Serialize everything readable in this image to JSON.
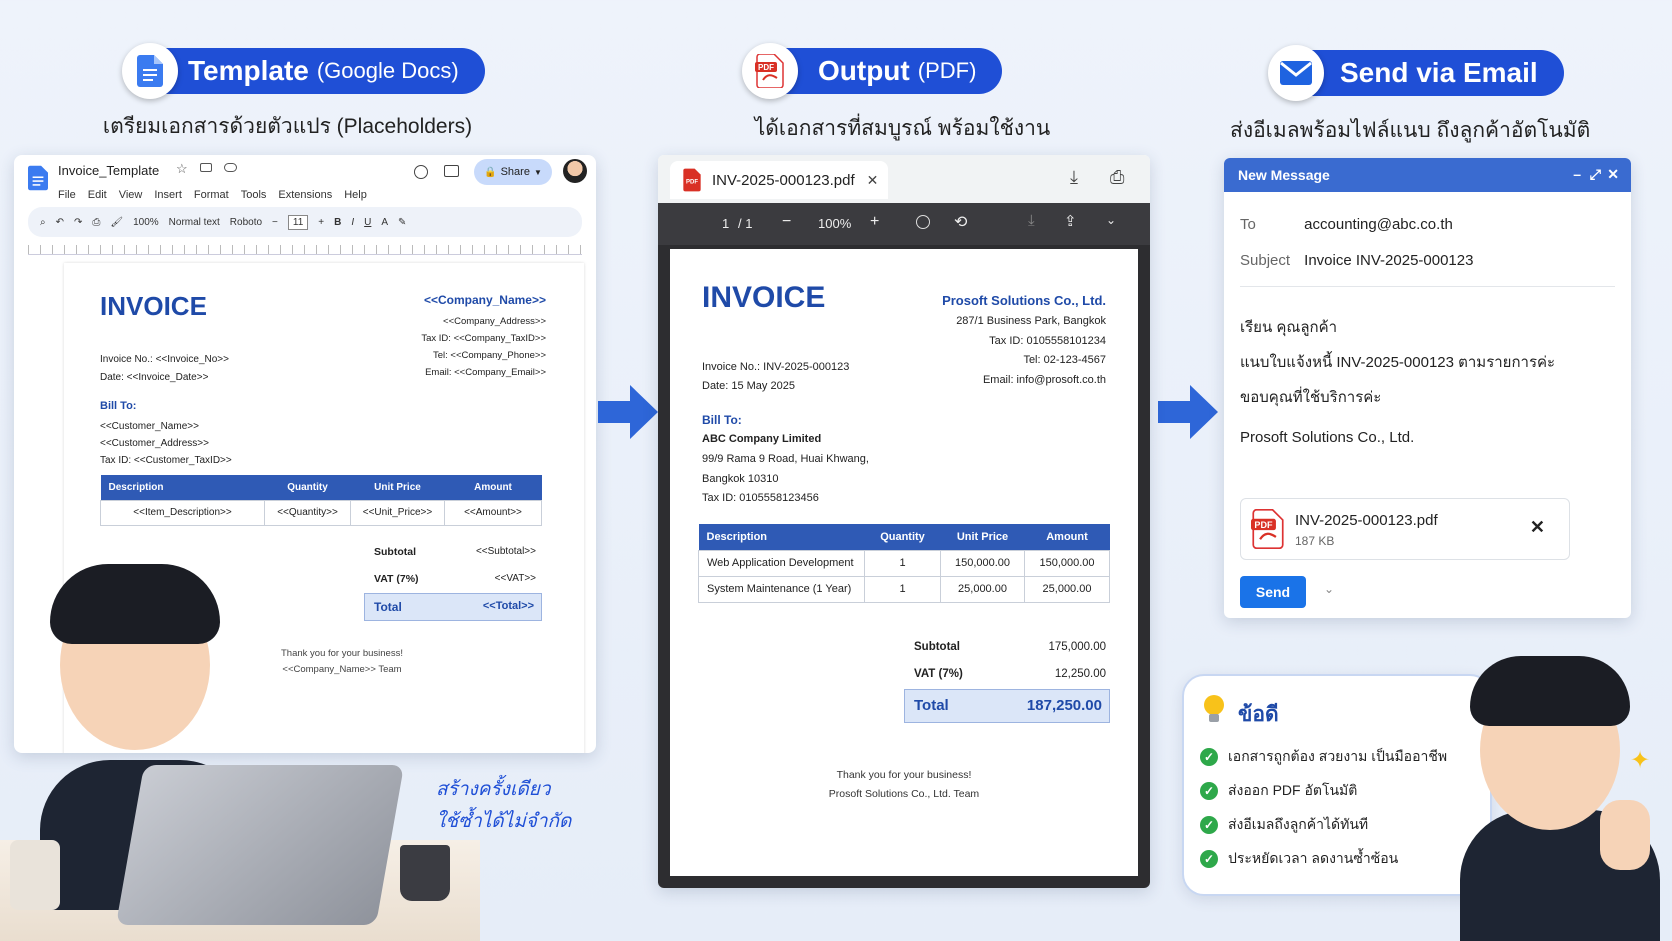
{
  "header": {
    "template_title": "Template",
    "template_sub": "(Google Docs)",
    "template_caption": "เตรียมเอกสารด้วยตัวแปร (Placeholders)",
    "output_title": "Output",
    "output_sub": "(PDF)",
    "output_caption": "ได้เอกสารที่สมบูรณ์ พร้อมใช้งาน",
    "email_title": "Send via Email",
    "email_caption": "ส่งอีเมลพร้อมไฟล์แนบ ถึงลูกค้าอัตโนมัติ"
  },
  "docs": {
    "filename": "Invoice_Template",
    "menu": [
      "File",
      "Edit",
      "View",
      "Insert",
      "Format",
      "Tools",
      "Extensions",
      "Help"
    ],
    "share_label": "Share",
    "zoom": "100%",
    "style": "Normal text",
    "font": "Roboto",
    "font_size": "11",
    "bold": "B",
    "italic": "I",
    "underline": "U",
    "color": "A",
    "invoice_title": "INVOICE",
    "company_name": "<<Company_Name>>",
    "company_lines": [
      "<<Company_Address>>",
      "Tax ID: <<Company_TaxID>>",
      "Tel: <<Company_Phone>>",
      "Email: <<Company_Email>>"
    ],
    "invoice_no": "Invoice No.: <<Invoice_No>>",
    "date": "Date: <<Invoice_Date>>",
    "bill_to": "Bill To:",
    "customer_lines": [
      "<<Customer_Name>>",
      "<<Customer_Address>>",
      "Tax ID: <<Customer_TaxID>>"
    ],
    "table_headers": [
      "Description",
      "Quantity",
      "Unit Price",
      "Amount"
    ],
    "table_row": [
      "<<Item_Description>>",
      "<<Quantity>>",
      "<<Unit_Price>>",
      "<<Amount>>"
    ],
    "subtotal_label": "Subtotal",
    "subtotal_value": "<<Subtotal>>",
    "vat_label": "VAT (7%)",
    "vat_value": "<<VAT>>",
    "total_label": "Total",
    "total_value": "<<Total>>",
    "thanks": "Thank you for your business!",
    "team": "<<Company_Name>> Team"
  },
  "pdf": {
    "tab_title": "INV-2025-000123.pdf",
    "page": "1",
    "page_total": "/ 1",
    "zoom": "100%",
    "invoice_title": "INVOICE",
    "company_name": "Prosoft Solutions Co., Ltd.",
    "company_lines": [
      "287/1 Business Park, Bangkok",
      "Tax ID: 0105558101234",
      "Tel: 02-123-4567",
      "Email: info@prosoft.co.th"
    ],
    "invoice_no": "Invoice No.: INV-2025-000123",
    "date": "Date: 15 May 2025",
    "bill_to": "Bill To:",
    "customer_name": "ABC Company Limited",
    "customer_lines": [
      "99/9 Rama 9 Road, Huai Khwang,",
      "Bangkok 10310",
      "Tax ID: 0105558123456"
    ],
    "table_headers": [
      "Description",
      "Quantity",
      "Unit Price",
      "Amount"
    ],
    "rows": [
      [
        "Web Application Development",
        "1",
        "150,000.00",
        "150,000.00"
      ],
      [
        "System Maintenance (1 Year)",
        "1",
        "25,000.00",
        "25,000.00"
      ]
    ],
    "subtotal_label": "Subtotal",
    "subtotal_value": "175,000.00",
    "vat_label": "VAT (7%)",
    "vat_value": "12,250.00",
    "total_label": "Total",
    "total_value": "187,250.00",
    "thanks": "Thank you for your business!",
    "team": "Prosoft Solutions Co., Ltd. Team"
  },
  "email": {
    "window_title": "New Message",
    "to_label": "To",
    "to_value": "accounting@abc.co.th",
    "subject_label": "Subject",
    "subject_value": "Invoice INV-2025-000123",
    "body": [
      "เรียน คุณลูกค้า",
      "แนบใบแจ้งหนี้ INV-2025-000123 ตามรายการค่ะ",
      "ขอบคุณที่ใช้บริการค่ะ",
      "Prosoft Solutions Co., Ltd."
    ],
    "attachment_name": "INV-2025-000123.pdf",
    "attachment_size": "187 KB",
    "send_label": "Send"
  },
  "benefits": {
    "title": "ข้อดี",
    "items": [
      "เอกสารถูกต้อง สวยงาม เป็นมืออาชีพ",
      "ส่งออก PDF อัตโนมัติ",
      "ส่งอีเมลถึงลูกค้าได้ทันที",
      "ประหยัดเวลา ลดงานซ้ำซ้อน"
    ]
  },
  "handwritten": [
    "สร้างครั้งเดียว",
    "ใช้ซ้ำได้ไม่จำกัด"
  ],
  "icons": {
    "docs": "google-docs-icon",
    "pdf": "pdf-icon",
    "mail": "mail-icon",
    "bulb": "lightbulb-icon"
  },
  "colors": {
    "accent": "#1f4fd6",
    "invoice_blue": "#1f4aa8",
    "table_header": "#2f5ab5",
    "send": "#1a73e8",
    "check": "#2ea84a"
  }
}
